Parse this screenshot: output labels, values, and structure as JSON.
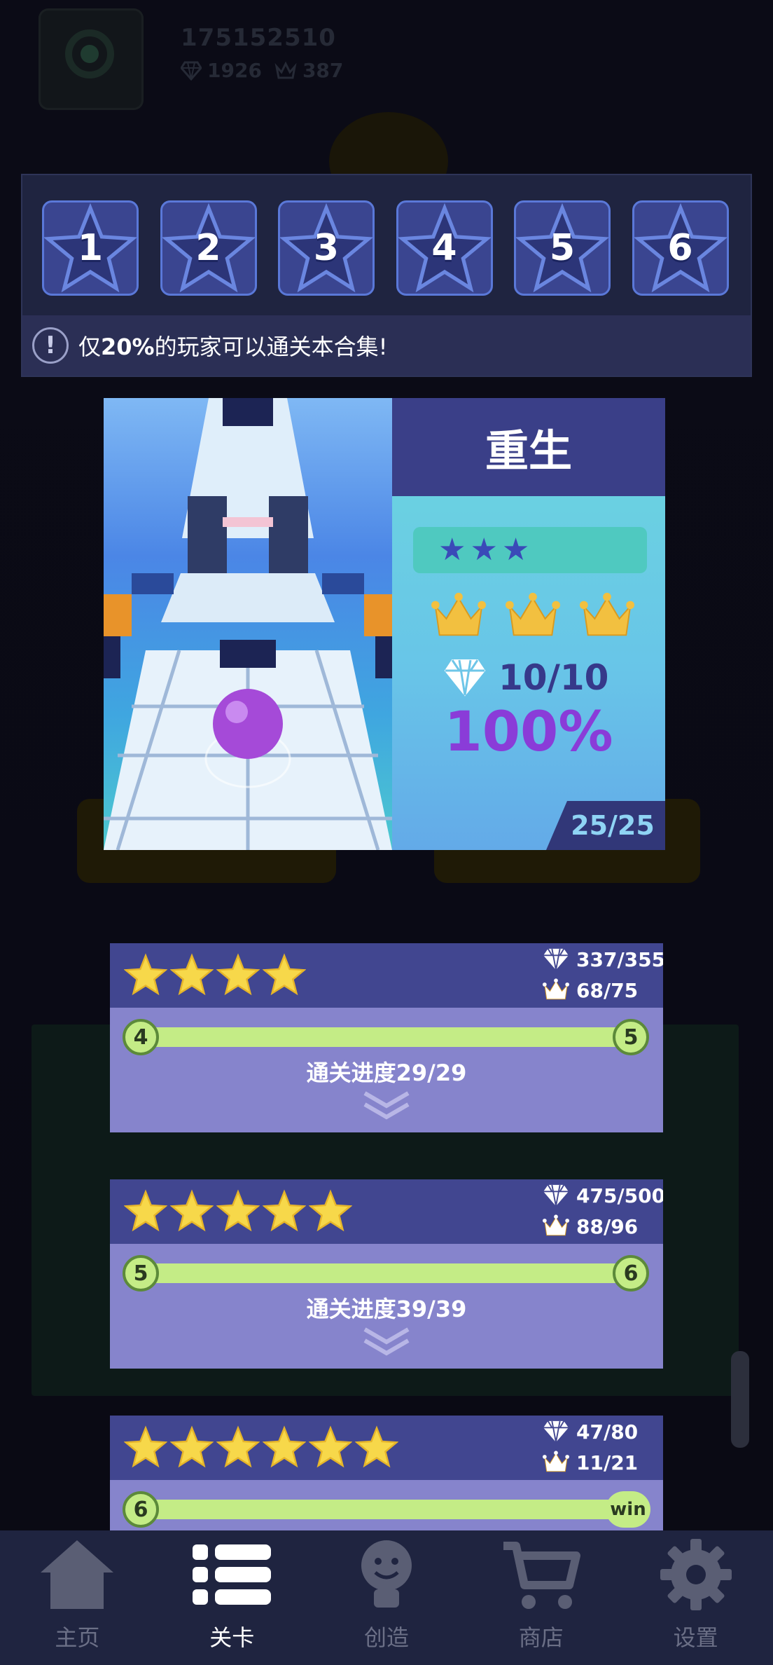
{
  "header": {
    "user_id": "175152510",
    "gems": "1926",
    "crowns": "387"
  },
  "collection": {
    "levels": [
      "1",
      "2",
      "3",
      "4",
      "5",
      "6"
    ],
    "hint_icon": "!",
    "hint_prefix": "仅",
    "hint_percent": "20%",
    "hint_suffix": "的玩家可以通关本合集!"
  },
  "level_card": {
    "title": "重生",
    "difficulty_stars": 3,
    "crowns_earned": 3,
    "gems": "10/10",
    "percent": "100%",
    "progress": "25/25"
  },
  "tiers": [
    {
      "stars": 4,
      "gems": "337/355",
      "crowns": "68/75",
      "from": "4",
      "to": "5",
      "progress": "通关进度29/29"
    },
    {
      "stars": 5,
      "gems": "475/500",
      "crowns": "88/96",
      "from": "5",
      "to": "6",
      "progress": "通关进度39/39"
    },
    {
      "stars": 6,
      "gems": "47/80",
      "crowns": "11/21",
      "from": "6",
      "to": "win"
    }
  ],
  "nav": {
    "items": [
      {
        "label": "主页",
        "icon": "home-icon"
      },
      {
        "label": "关卡",
        "icon": "list-icon"
      },
      {
        "label": "创造",
        "icon": "lightbulb-icon"
      },
      {
        "label": "商店",
        "icon": "cart-icon"
      },
      {
        "label": "设置",
        "icon": "gear-icon"
      }
    ],
    "active_index": 1
  },
  "colors": {
    "panel": "#1f2440",
    "star_tile": "#3a4590",
    "tier_head": "#414690",
    "tier_body": "#8684cc",
    "track": "#c4ec86",
    "percent": "#8a3cd8",
    "crown": "#f2c040"
  }
}
